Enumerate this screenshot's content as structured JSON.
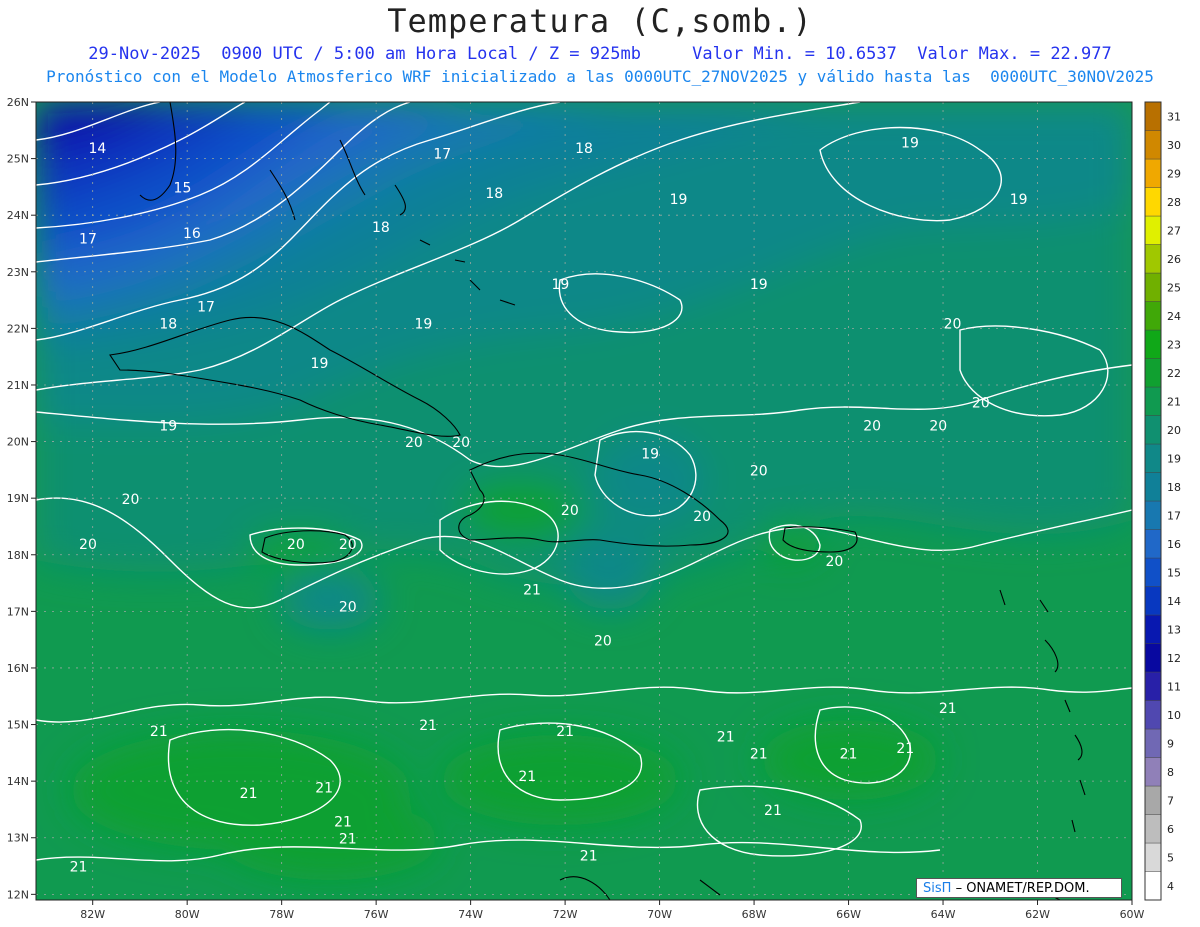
{
  "title": "Temperatura (C,somb.)",
  "subtitle_line1": "29-Nov-2025  0900 UTC / 5:00 am Hora Local / Z = 925mb     Valor Min. = 10.6537  Valor Max. = 22.977",
  "subtitle_line2": "Pronóstico con el Modelo Atmosferico WRF inicializado a las 0000UTC_27NOV2025 y válido hasta las  0000UTC_30NOV2025",
  "credit": {
    "logo": "SisΠ",
    "text": "– ONAMET/REP.DOM."
  },
  "map_data": {
    "variable": "Temperatura",
    "units": "C",
    "level": "925mb",
    "valid_time": "29-Nov-2025 0900 UTC",
    "lon_range": [
      -83.2,
      -60
    ],
    "lat_range": [
      11.9,
      26
    ],
    "y_ticks": [
      {
        "lat": 26,
        "label": "26N"
      },
      {
        "lat": 25,
        "label": "25N"
      },
      {
        "lat": 24,
        "label": "24N"
      },
      {
        "lat": 23,
        "label": "23N"
      },
      {
        "lat": 22,
        "label": "22N"
      },
      {
        "lat": 21,
        "label": "21N"
      },
      {
        "lat": 20,
        "label": "20N"
      },
      {
        "lat": 19,
        "label": "19N"
      },
      {
        "lat": 18,
        "label": "18N"
      },
      {
        "lat": 17,
        "label": "17N"
      },
      {
        "lat": 16,
        "label": "16N"
      },
      {
        "lat": 15,
        "label": "15N"
      },
      {
        "lat": 14,
        "label": "14N"
      },
      {
        "lat": 13,
        "label": "13N"
      },
      {
        "lat": 12,
        "label": "12N"
      }
    ],
    "x_ticks": [
      {
        "lon": -82,
        "label": "82W"
      },
      {
        "lon": -80,
        "label": "80W"
      },
      {
        "lon": -78,
        "label": "78W"
      },
      {
        "lon": -76,
        "label": "76W"
      },
      {
        "lon": -74,
        "label": "74W"
      },
      {
        "lon": -72,
        "label": "72W"
      },
      {
        "lon": -70,
        "label": "70W"
      },
      {
        "lon": -68,
        "label": "68W"
      },
      {
        "lon": -66,
        "label": "66W"
      },
      {
        "lon": -64,
        "label": "64W"
      },
      {
        "lon": -62,
        "label": "62W"
      },
      {
        "lon": -60,
        "label": "60W"
      }
    ],
    "colorbar": [
      {
        "value": 4,
        "color": "#ffffff"
      },
      {
        "value": 5,
        "color": "#d9d9d9"
      },
      {
        "value": 6,
        "color": "#bdbdbd"
      },
      {
        "value": 7,
        "color": "#a8a8a8"
      },
      {
        "value": 8,
        "color": "#9080b8"
      },
      {
        "value": 9,
        "color": "#7068b4"
      },
      {
        "value": 10,
        "color": "#5048b0"
      },
      {
        "value": 11,
        "color": "#2820a8"
      },
      {
        "value": 12,
        "color": "#0808a0"
      },
      {
        "value": 13,
        "color": "#0818b0"
      },
      {
        "value": 14,
        "color": "#0838c0"
      },
      {
        "value": 15,
        "color": "#1050c8"
      },
      {
        "value": 16,
        "color": "#2068c8"
      },
      {
        "value": 17,
        "color": "#1878b0"
      },
      {
        "value": 18,
        "color": "#108098"
      },
      {
        "value": 19,
        "color": "#108888"
      },
      {
        "value": 20,
        "color": "#109070"
      },
      {
        "value": 21,
        "color": "#109a50"
      },
      {
        "value": 22,
        "color": "#10a030"
      },
      {
        "value": 23,
        "color": "#10a818"
      },
      {
        "value": 24,
        "color": "#40a808"
      },
      {
        "value": 25,
        "color": "#70b000"
      },
      {
        "value": 26,
        "color": "#a0c800"
      },
      {
        "value": 27,
        "color": "#e0f000"
      },
      {
        "value": 28,
        "color": "#ffd800"
      },
      {
        "value": 29,
        "color": "#f0a800"
      },
      {
        "value": 30,
        "color": "#d08800"
      },
      {
        "value": 31,
        "color": "#b87000"
      }
    ],
    "contour_labels": [
      {
        "text": "14",
        "lon": -81.9,
        "lat": 25.1
      },
      {
        "text": "15",
        "lon": -80.1,
        "lat": 24.4
      },
      {
        "text": "16",
        "lon": -79.9,
        "lat": 23.6
      },
      {
        "text": "17",
        "lon": -82.1,
        "lat": 23.5
      },
      {
        "text": "17",
        "lon": -79.6,
        "lat": 22.3
      },
      {
        "text": "18",
        "lon": -80.4,
        "lat": 22.0
      },
      {
        "text": "17",
        "lon": -74.6,
        "lat": 25.0
      },
      {
        "text": "18",
        "lon": -71.6,
        "lat": 25.1
      },
      {
        "text": "18",
        "lon": -73.5,
        "lat": 24.3
      },
      {
        "text": "18",
        "lon": -75.9,
        "lat": 23.7
      },
      {
        "text": "19",
        "lon": -64.7,
        "lat": 25.2
      },
      {
        "text": "19",
        "lon": -69.6,
        "lat": 24.2
      },
      {
        "text": "19",
        "lon": -62.4,
        "lat": 24.2
      },
      {
        "text": "19",
        "lon": -72.1,
        "lat": 22.7
      },
      {
        "text": "19",
        "lon": -67.9,
        "lat": 22.7
      },
      {
        "text": "19",
        "lon": -75.0,
        "lat": 22.0
      },
      {
        "text": "19",
        "lon": -77.2,
        "lat": 21.3
      },
      {
        "text": "19",
        "lon": -80.4,
        "lat": 20.2
      },
      {
        "text": "20",
        "lon": -63.8,
        "lat": 22.0
      },
      {
        "text": "20",
        "lon": -63.2,
        "lat": 20.6
      },
      {
        "text": "20",
        "lon": -64.1,
        "lat": 20.2
      },
      {
        "text": "20",
        "lon": -65.5,
        "lat": 20.2
      },
      {
        "text": "20",
        "lon": -75.2,
        "lat": 19.9
      },
      {
        "text": "20",
        "lon": -74.2,
        "lat": 19.9
      },
      {
        "text": "19",
        "lon": -70.2,
        "lat": 19.7
      },
      {
        "text": "20",
        "lon": -67.9,
        "lat": 19.4
      },
      {
        "text": "20",
        "lon": -81.2,
        "lat": 18.9
      },
      {
        "text": "20",
        "lon": -71.9,
        "lat": 18.7
      },
      {
        "text": "20",
        "lon": -69.1,
        "lat": 18.6
      },
      {
        "text": "20",
        "lon": -82.1,
        "lat": 18.1
      },
      {
        "text": "20",
        "lon": -77.7,
        "lat": 18.1
      },
      {
        "text": "20",
        "lon": -76.6,
        "lat": 18.1
      },
      {
        "text": "20",
        "lon": -66.3,
        "lat": 17.8
      },
      {
        "text": "21",
        "lon": -72.7,
        "lat": 17.3
      },
      {
        "text": "20",
        "lon": -76.6,
        "lat": 17.0
      },
      {
        "text": "20",
        "lon": -71.2,
        "lat": 16.4
      },
      {
        "text": "21",
        "lon": -63.9,
        "lat": 15.2
      },
      {
        "text": "21",
        "lon": -80.6,
        "lat": 14.8
      },
      {
        "text": "21",
        "lon": -74.9,
        "lat": 14.9
      },
      {
        "text": "21",
        "lon": -72.0,
        "lat": 14.8
      },
      {
        "text": "21",
        "lon": -68.6,
        "lat": 14.7
      },
      {
        "text": "21",
        "lon": -67.9,
        "lat": 14.4
      },
      {
        "text": "21",
        "lon": -66.0,
        "lat": 14.4
      },
      {
        "text": "21",
        "lon": -64.8,
        "lat": 14.5
      },
      {
        "text": "21",
        "lon": -72.8,
        "lat": 14.0
      },
      {
        "text": "21",
        "lon": -77.1,
        "lat": 13.8
      },
      {
        "text": "21",
        "lon": -78.7,
        "lat": 13.7
      },
      {
        "text": "21",
        "lon": -67.6,
        "lat": 13.4
      },
      {
        "text": "21",
        "lon": -76.7,
        "lat": 13.2
      },
      {
        "text": "21",
        "lon": -76.6,
        "lat": 12.9
      },
      {
        "text": "21",
        "lon": -71.5,
        "lat": 12.6
      },
      {
        "text": "21",
        "lon": -82.3,
        "lat": 12.4
      }
    ]
  }
}
